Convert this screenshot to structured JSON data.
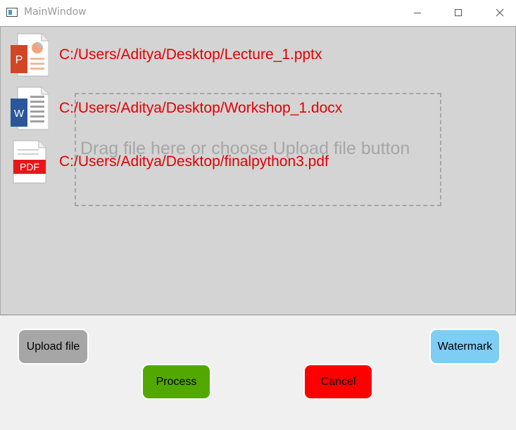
{
  "window": {
    "title": "MainWindow"
  },
  "drop_zone": {
    "hint": "Drag file here or choose Upload file button"
  },
  "files": [
    {
      "path": "C:/Users/Aditya/Desktop/Lecture_1.pptx",
      "icon": "powerpoint-file-icon"
    },
    {
      "path": "C:/Users/Aditya/Desktop/Workshop_1.docx",
      "icon": "word-file-icon"
    },
    {
      "path": "C:/Users/Aditya/Desktop/finalpython3.pdf",
      "icon": "pdf-file-icon"
    }
  ],
  "buttons": {
    "upload": "Upload file",
    "watermark": "Watermark",
    "process": "Process",
    "cancel": "Cancel"
  },
  "icon_labels": {
    "ppt": "P",
    "word": "W",
    "pdf": "PDF"
  },
  "colors": {
    "file_path_text": "#e10000",
    "upload_button": "#a6a6a6",
    "watermark_button": "#7ecdf5",
    "process_button": "#53a800",
    "cancel_button": "#ff0000"
  }
}
